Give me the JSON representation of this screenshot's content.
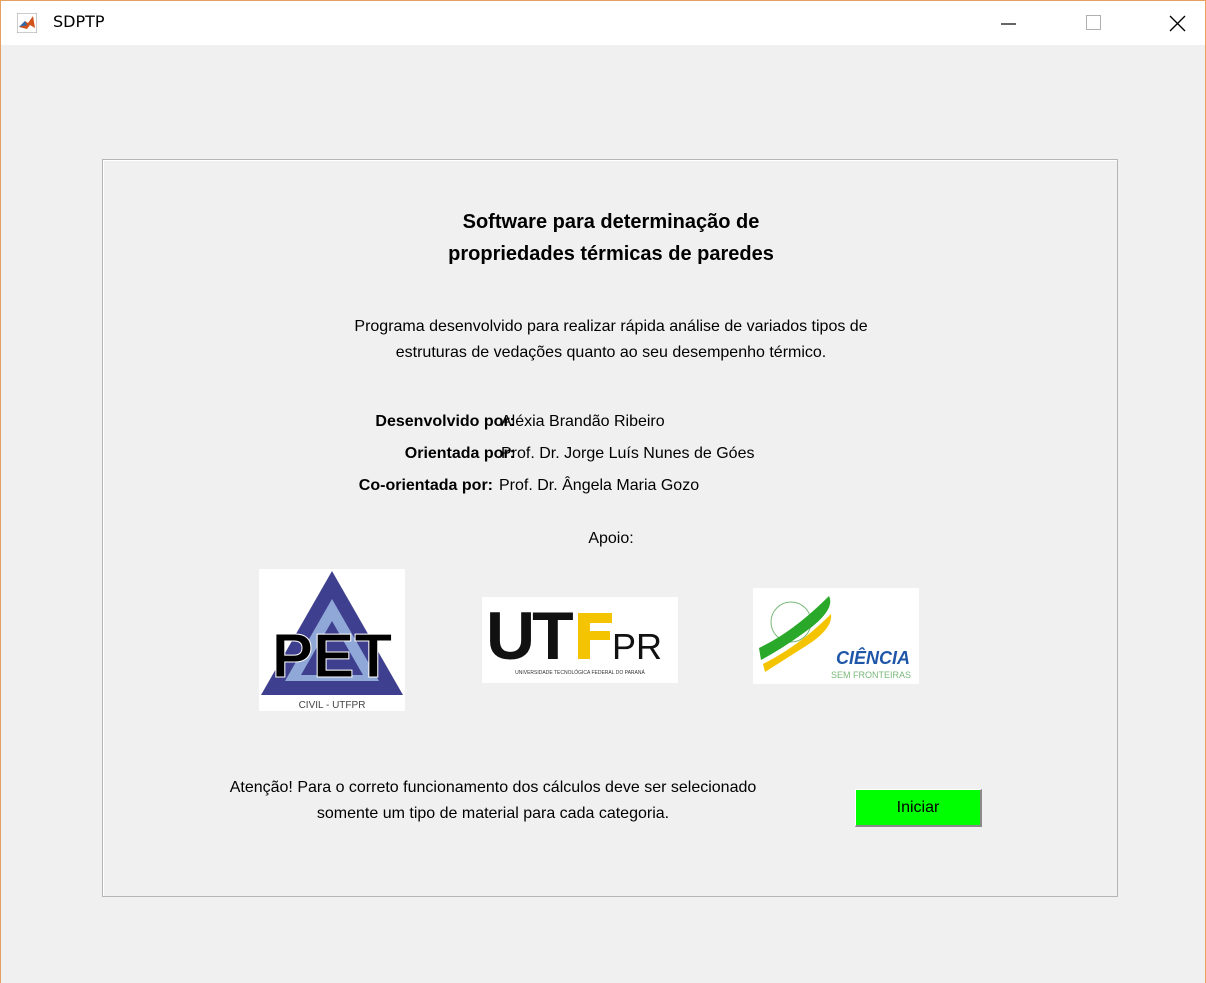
{
  "window": {
    "title": "SDPTP",
    "icons": {
      "app": "matlab-icon",
      "minimize": "minimize-icon",
      "maximize": "maximize-icon",
      "close": "close-icon"
    }
  },
  "main": {
    "heading_line1": "Software para determinação de",
    "heading_line2": "propriedades térmicas de paredes",
    "description_line1": "Programa desenvolvido para realizar rápida análise de variados tipos de",
    "description_line2": "estruturas de vedações quanto ao seu desempenho térmico.",
    "credits": [
      {
        "label": "Desenvolvido por:",
        "value": "Aléxia Brandão Ribeiro"
      },
      {
        "label": "Orientada por:",
        "value": "Prof. Dr. Jorge Luís Nunes de Góes"
      },
      {
        "label": "Co-orientada por:",
        "value": "Prof. Dr. Ângela Maria Gozo"
      }
    ],
    "support_label": "Apoio:",
    "logos": {
      "pet": {
        "text": "PET",
        "subtext": "CIVIL - UTFPR"
      },
      "utfpr": {
        "text_ut": "UT",
        "text_pr": "PR",
        "subtext": "UNIVERSIDADE TECNOLÓGICA FEDERAL DO PARANÁ"
      },
      "ciencia": {
        "text": "CIÊNCIA",
        "subtext": "SEM FRONTEIRAS"
      }
    },
    "warning_line1": "Atenção! Para o correto funcionamento dos cálculos deve ser selecionado",
    "warning_line2": "somente um tipo de material para cada categoria.",
    "start_button_label": "Iniciar"
  },
  "colors": {
    "start_button": "#00ff00",
    "pet_triangle": "#3f3f8f",
    "utfpr_yellow": "#f5c400",
    "ciencia_green": "#2aa82a",
    "ciencia_blue": "#1f56a8"
  }
}
